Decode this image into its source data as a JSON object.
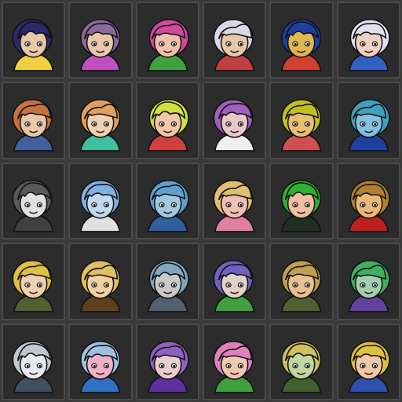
{
  "portraits": [
    {
      "name": "portrait-1",
      "hair": "#2a2a6a",
      "skin": "#e8c8a8",
      "accent": "#f0d040"
    },
    {
      "name": "portrait-2",
      "hair": "#8a6a9a",
      "skin": "#e8c8a8",
      "accent": "#c050c0"
    },
    {
      "name": "portrait-3",
      "hair": "#d04aa0",
      "skin": "#f0c0a8",
      "accent": "#40a040"
    },
    {
      "name": "portrait-4",
      "hair": "#d8d8e8",
      "skin": "#e8c8a8",
      "accent": "#c04040"
    },
    {
      "name": "portrait-5",
      "hair": "#2040a0",
      "skin": "#e0b850",
      "accent": "#d04030"
    },
    {
      "name": "portrait-6",
      "hair": "#e0e0f0",
      "skin": "#f0d0c0",
      "accent": "#3060c0"
    },
    {
      "name": "portrait-7",
      "hair": "#c87040",
      "skin": "#e8c8a8",
      "accent": "#4060a0"
    },
    {
      "name": "portrait-8",
      "hair": "#e0a060",
      "skin": "#f0d0b0",
      "accent": "#40c0a0"
    },
    {
      "name": "portrait-9",
      "hair": "#d0e040",
      "skin": "#f0c8a8",
      "accent": "#d04040"
    },
    {
      "name": "portrait-10",
      "hair": "#a060c0",
      "skin": "#e8c8c8",
      "accent": "#f0f0f0"
    },
    {
      "name": "portrait-11",
      "hair": "#c0c020",
      "skin": "#e8c070",
      "accent": "#d05050"
    },
    {
      "name": "portrait-12",
      "hair": "#40a0c0",
      "skin": "#80c0e0",
      "accent": "#2040a0"
    },
    {
      "name": "portrait-13",
      "hair": "#5a5a5a",
      "skin": "#e0e0e0",
      "accent": "#404040"
    },
    {
      "name": "portrait-14",
      "hair": "#80b0e0",
      "skin": "#c0d8f0",
      "accent": "#e0e0e0"
    },
    {
      "name": "portrait-15",
      "hair": "#60a0d0",
      "skin": "#a0c8e0",
      "accent": "#3060a0"
    },
    {
      "name": "portrait-16",
      "hair": "#e0c070",
      "skin": "#f0c0b0",
      "accent": "#e080a0"
    },
    {
      "name": "portrait-17",
      "hair": "#30b030",
      "skin": "#f0c0a0",
      "accent": "#203020"
    },
    {
      "name": "portrait-18",
      "hair": "#b08030",
      "skin": "#e8b878",
      "accent": "#c02020"
    },
    {
      "name": "portrait-19",
      "hair": "#e0c040",
      "skin": "#f0d0b0",
      "accent": "#506030"
    },
    {
      "name": "portrait-20",
      "hair": "#e0c060",
      "skin": "#f0d0a0",
      "accent": "#604020"
    },
    {
      "name": "portrait-21",
      "hair": "#80a8c0",
      "skin": "#c8c8c8",
      "accent": "#506070"
    },
    {
      "name": "portrait-22",
      "hair": "#7060c0",
      "skin": "#e0d0c8",
      "accent": "#40a040"
    },
    {
      "name": "portrait-23",
      "hair": "#c0a050",
      "skin": "#e8c090",
      "accent": "#506030"
    },
    {
      "name": "portrait-24",
      "hair": "#40b060",
      "skin": "#a0d0b0",
      "accent": "#6040a0"
    },
    {
      "name": "portrait-25",
      "hair": "#c0c8d0",
      "skin": "#e8e8f0",
      "accent": "#405060"
    },
    {
      "name": "portrait-26",
      "hair": "#a0c0e0",
      "skin": "#f0b0c8",
      "accent": "#3070c0"
    },
    {
      "name": "portrait-27",
      "hair": "#9060c0",
      "skin": "#e8d0d0",
      "accent": "#6030a0"
    },
    {
      "name": "portrait-28",
      "hair": "#e080c0",
      "skin": "#f0c8b0",
      "accent": "#40a040"
    },
    {
      "name": "portrait-29",
      "hair": "#d0c060",
      "skin": "#c0d8a0",
      "accent": "#406030"
    },
    {
      "name": "portrait-30",
      "hair": "#e0c040",
      "skin": "#f0c8a8",
      "accent": "#3050b0"
    }
  ]
}
